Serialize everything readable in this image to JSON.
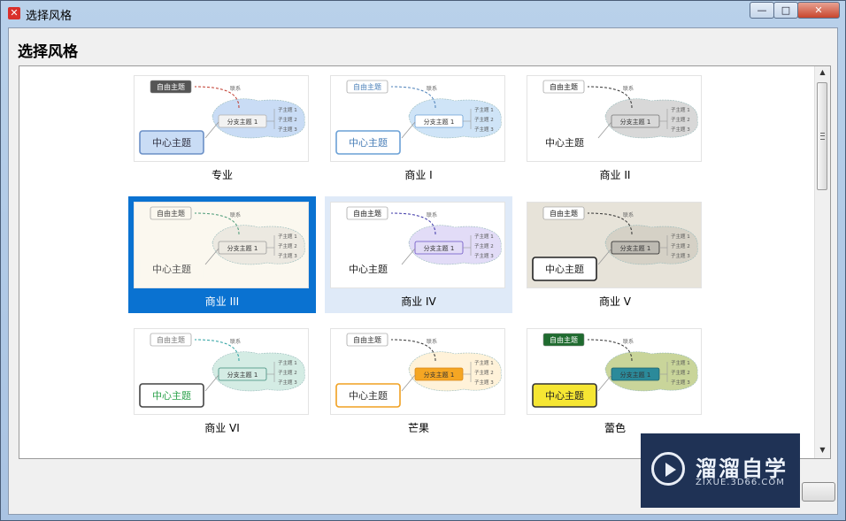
{
  "window": {
    "app_icon": "xmind-x-icon",
    "title": "选择风格",
    "controls": {
      "minimize": "—",
      "maximize": "□",
      "close": "✕"
    }
  },
  "dialog": {
    "heading": "选择风格"
  },
  "themes": [
    {
      "label": "专业",
      "central": "中心主题",
      "branch": "分支主题 1",
      "floating": "自由主题",
      "relation": "联系",
      "subtopics": [
        "子主题 1",
        "子主题 2",
        "子主题 3"
      ]
    },
    {
      "label": "商业 I",
      "central": "中心主题",
      "branch": "分支主题 1",
      "floating": "自由主题",
      "relation": "联系",
      "subtopics": [
        "子主题 1",
        "子主题 2",
        "子主题 3"
      ]
    },
    {
      "label": "商业 II",
      "central": "中心主题",
      "branch": "分支主题 1",
      "floating": "自由主题",
      "relation": "联系",
      "subtopics": [
        "子主题 1",
        "子主题 2",
        "子主题 3"
      ]
    },
    {
      "label": "商业 III",
      "central": "中心主题",
      "branch": "分支主题 1",
      "floating": "自由主题",
      "relation": "联系",
      "subtopics": [
        "子主题 1",
        "子主题 2",
        "子主题 3"
      ],
      "selected": true
    },
    {
      "label": "商业 IV",
      "central": "中心主题",
      "branch": "分支主题 1",
      "floating": "自由主题",
      "relation": "联系",
      "subtopics": [
        "子主题 1",
        "子主题 2",
        "子主题 3"
      ]
    },
    {
      "label": "商业 V",
      "central": "中心主题",
      "branch": "分支主题 1",
      "floating": "自由主题",
      "relation": "联系",
      "subtopics": [
        "子主题 1",
        "子主题 2",
        "子主题 3"
      ]
    },
    {
      "label": "商业 VI",
      "central": "中心主题",
      "branch": "分支主题 1",
      "floating": "自由主题",
      "relation": "联系",
      "subtopics": [
        "子主题 1",
        "子主题 2",
        "子主题 3"
      ]
    },
    {
      "label": "芒果",
      "central": "中心主题",
      "branch": "分支主题 1",
      "floating": "自由主题",
      "relation": "联系",
      "subtopics": [
        "子主题 1",
        "子主题 2",
        "子主题 3"
      ]
    },
    {
      "label": "蕾色",
      "central": "中心主题",
      "branch": "分支主题 1",
      "floating": "自由主题",
      "relation": "联系",
      "subtopics": [
        "子主题 1",
        "子主题 2",
        "子主题 3"
      ]
    }
  ],
  "scrollbar": {
    "up_icon": "▲",
    "down_icon": "▼"
  },
  "watermark": {
    "brand": "溜溜自学",
    "url": "ZIXUE.3D66.COM"
  },
  "colors": {
    "selection": "#0a72d1",
    "hover": "#dfeaf8"
  }
}
